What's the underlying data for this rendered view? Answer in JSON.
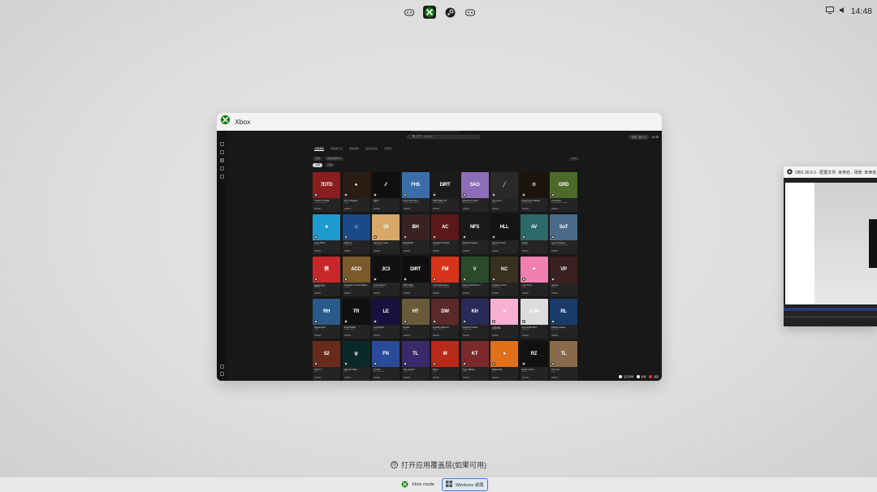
{
  "topbar": {
    "icons": [
      "gamepad-icon",
      "xbox-icon",
      "steam-icon",
      "gamepad-icon"
    ],
    "clock": "14:48"
  },
  "main_window": {
    "title": "Xbox",
    "app": {
      "search_placeholder": "🔍 打开 · Xbox (F)",
      "account_pill": "登录 · 帐户 2",
      "time": "14:48",
      "tabs": [
        "全部游戏",
        "游戏通行证",
        "我的游戏",
        "最近玩过的",
        "已安装"
      ],
      "active_tab": 0,
      "filters": [
        "筛选",
        "按标题排序 ▾",
        "全部",
        "可用"
      ],
      "sort_label": "A–Z",
      "games": [
        {
          "name": "7 DAYS TO DIE",
          "pub": "The Fun Pimps",
          "color": "#8a1d1d",
          "label": "7DTD"
        },
        {
          "name": "Ace of Spades",
          "pub": "Jagex",
          "color": "#2b1d14",
          "label": "♠"
        },
        {
          "name": "AIM 7",
          "pub": "Indie",
          "color": "#0f0f0f",
          "label": "⁄⁄"
        },
        {
          "name": "Forza Horizon 5",
          "pub": "Xbox Game Studios",
          "color": "#3b6ea8",
          "label": "FH5"
        },
        {
          "name": "DiRT Rally 2.0",
          "pub": "Codemasters",
          "color": "#1b1b1b",
          "label": "DiRT"
        },
        {
          "name": "Sword Art Online",
          "pub": "Bandai Namco",
          "color": "#8c6db8",
          "label": "SAO"
        },
        {
          "name": "Pen Lost 4",
          "pub": "Indie",
          "color": "#2a2a2a",
          "label": "╱"
        },
        {
          "name": "Deep Rock Galactic",
          "pub": "Coffee Stain",
          "color": "#1c140c",
          "label": "⚙"
        },
        {
          "name": "Grounded",
          "pub": "Xbox Game Studios",
          "color": "#4e6a2a",
          "label": "GRD"
        },
        {
          "name": "Angry Birds",
          "pub": "Rovio",
          "color": "#1d9bd1",
          "label": "★"
        },
        {
          "name": "Fallout 4",
          "pub": "Bethesda",
          "color": "#1a4a8a",
          "label": "☺"
        },
        {
          "name": "Genshin Impact",
          "pub": "HoYoverse",
          "color": "#d8a868",
          "label": "GI"
        },
        {
          "name": "Brawlhalla",
          "pub": "Ubisoft",
          "color": "#3a2222",
          "label": "BH"
        },
        {
          "name": "Assassin's Creed",
          "pub": "Ubisoft",
          "color": "#5a1818",
          "label": "AC"
        },
        {
          "name": "Need for Speed",
          "pub": "EA",
          "color": "#1a1a1a",
          "label": "NFS"
        },
        {
          "name": "Hell Let Loose",
          "pub": "Team17",
          "color": "#141414",
          "label": "HLL"
        },
        {
          "name": "Avatar",
          "pub": "Ubisoft",
          "color": "#2a6a6a",
          "label": "AV"
        },
        {
          "name": "Sea of Thieves",
          "pub": "Xbox Game Studios",
          "color": "#4a6a8a",
          "label": "SoT"
        },
        {
          "name": "侠客风云传",
          "pub": "Heluo",
          "color": "#c8282a",
          "label": "侠"
        },
        {
          "name": "Assassin's Creed Origins",
          "pub": "Ubisoft",
          "color": "#7a5a2a",
          "label": "ACO"
        },
        {
          "name": "Just Cause 3",
          "pub": "Square Enix",
          "color": "#111111",
          "label": "JC3"
        },
        {
          "name": "DiRT Rally",
          "pub": "Codemasters",
          "color": "#0f0f0f",
          "label": "DiRT"
        },
        {
          "name": "Forza Motorsport",
          "pub": "Xbox Game Studios",
          "color": "#d8341c",
          "label": "FM"
        },
        {
          "name": "Grand Theft Auto V",
          "pub": "Rockstar",
          "color": "#2a4a2a",
          "label": "V"
        },
        {
          "name": "Kingdom Come",
          "pub": "Warhorse",
          "color": "#3a3020",
          "label": "KC"
        },
        {
          "name": "Love Story",
          "pub": "Indie",
          "color": "#f080b0",
          "label": "♥"
        },
        {
          "name": "Vampyr",
          "pub": "Focus",
          "color": "#3a2020",
          "label": "VP"
        },
        {
          "name": "Rogue Hero",
          "pub": "Indie",
          "color": "#2a5a8a",
          "label": "RH"
        },
        {
          "name": "Tomb Raider",
          "pub": "Square Enix",
          "color": "#111111",
          "label": "TR"
        },
        {
          "name": "Lost Epoch",
          "pub": "Indie",
          "color": "#1a1040",
          "label": "LE"
        },
        {
          "name": "Hunter",
          "pub": "Indie",
          "color": "#6a5a3a",
          "label": "HT"
        },
        {
          "name": "Dynasty Warriors",
          "pub": "Koei Tecmo",
          "color": "#5a2a2a",
          "label": "DW"
        },
        {
          "name": "Kingdom Hearts",
          "pub": "Square Enix",
          "color": "#2a2a5a",
          "label": "KH"
        },
        {
          "name": "恋爱模拟",
          "pub": "Indie",
          "color": "#f8b0d0",
          "label": "♥"
        },
        {
          "name": "Age of Wonders",
          "pub": "Paradox",
          "color": "#dcdcdc",
          "label": "AoW"
        },
        {
          "name": "Rocket League",
          "pub": "Psyonix",
          "color": "#1a3a6a",
          "label": "RL"
        },
        {
          "name": "Storm 2",
          "pub": "Indie",
          "color": "#6a2a1a",
          "label": "S2"
        },
        {
          "name": "Valorant Tides",
          "pub": "Riot",
          "color": "#0a2a2a",
          "label": "ψ"
        },
        {
          "name": "Fortnite",
          "pub": "Epic Games",
          "color": "#2a4a9a",
          "label": "FN"
        },
        {
          "name": "The Legend",
          "pub": "Indie",
          "color": "#3a2a6a",
          "label": "TL"
        },
        {
          "name": "Mario",
          "pub": "Indie",
          "color": "#b82a1a",
          "label": "M"
        },
        {
          "name": "Keep Talking",
          "pub": "Indie",
          "color": "#7a2a2a",
          "label": "KT"
        },
        {
          "name": "Basketball",
          "pub": "Indie",
          "color": "#e0701a",
          "label": "●"
        },
        {
          "name": "Razer Cortex",
          "pub": "Razer",
          "color": "#111111",
          "label": "RZ"
        },
        {
          "name": "The Last",
          "pub": "Indie",
          "color": "#8a6a4a",
          "label": "TL"
        }
      ],
      "overlay_buttons": [
        {
          "label": "显示菜单",
          "key_color": "#ffffff"
        },
        {
          "label": "选择",
          "key_color": "#ffffff"
        },
        {
          "label": "返回",
          "key_color": "#e33333"
        }
      ]
    }
  },
  "side_window": {
    "title": "OBS 30.0.2 - 配置文件: 未命名 - 场景: 未命名"
  },
  "hint": "打开应用覆盖层(如果可用)",
  "taskbar": {
    "items": [
      {
        "label": "Xbox mode",
        "active": false
      },
      {
        "label": "Windows 桌面",
        "active": true
      }
    ]
  },
  "colors": {
    "xbox_green": "#107c10",
    "accent_blue": "#3b78d8"
  }
}
